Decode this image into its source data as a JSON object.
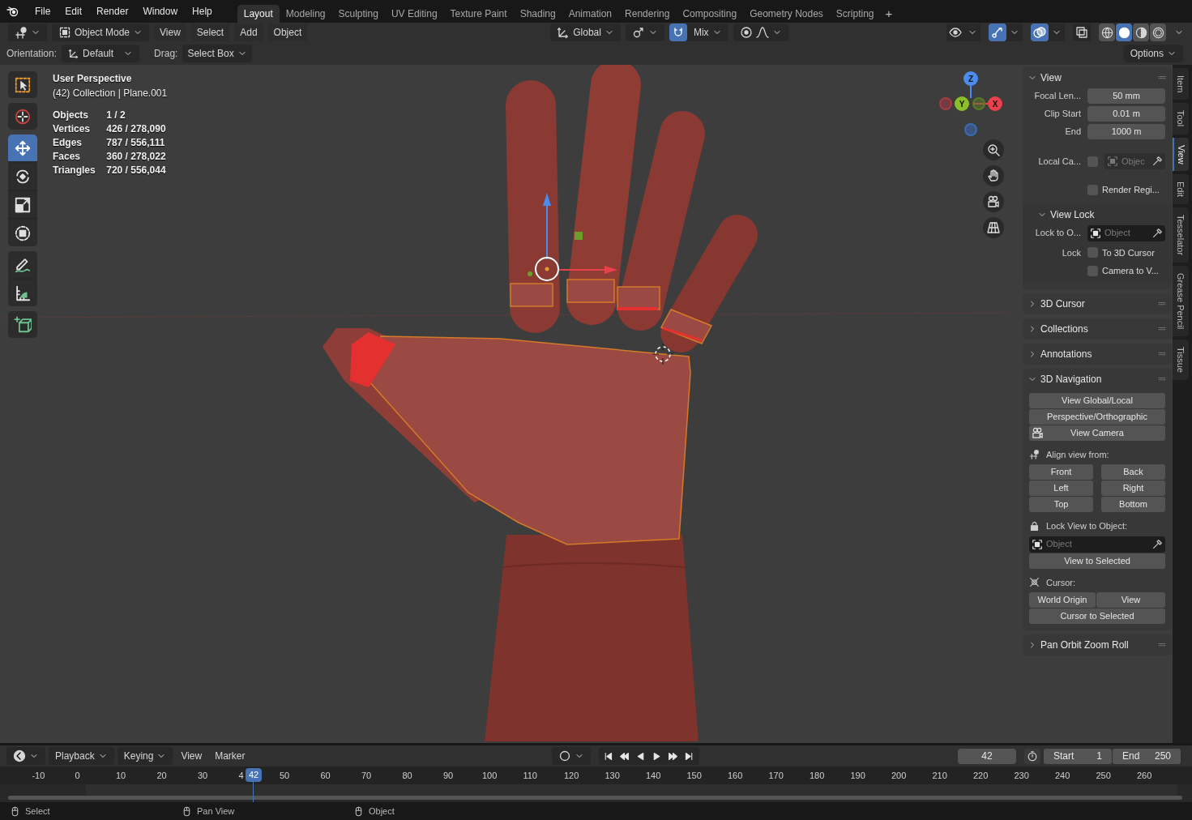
{
  "menu_bar": {
    "menus": [
      "File",
      "Edit",
      "Render",
      "Window",
      "Help"
    ],
    "workspaces": [
      {
        "label": "Layout",
        "selected": true
      },
      {
        "label": "Modeling",
        "selected": false
      },
      {
        "label": "Sculpting",
        "selected": false
      },
      {
        "label": "UV Editing",
        "selected": false
      },
      {
        "label": "Texture Paint",
        "selected": false
      },
      {
        "label": "Shading",
        "selected": false
      },
      {
        "label": "Animation",
        "selected": false
      },
      {
        "label": "Rendering",
        "selected": false
      },
      {
        "label": "Compositing",
        "selected": false
      },
      {
        "label": "Geometry Nodes",
        "selected": false
      },
      {
        "label": "Scripting",
        "selected": false
      }
    ],
    "add_tab": "+"
  },
  "header": {
    "mode": "Object Mode",
    "menus": [
      "View",
      "Select",
      "Add",
      "Object"
    ],
    "orientation": "Global",
    "snap_on": true,
    "snap_target": "Mix",
    "viewport_toggles": [
      {
        "kind": "visibility",
        "on": false
      },
      {
        "kind": "gizmos",
        "on": true
      },
      {
        "kind": "overlays",
        "on": true
      },
      {
        "kind": "xray",
        "on": false
      }
    ],
    "shading_modes": [
      {
        "kind": "wireframe",
        "selected": false
      },
      {
        "kind": "solid",
        "selected": true
      },
      {
        "kind": "material",
        "selected": false
      },
      {
        "kind": "rendered",
        "selected": false
      }
    ]
  },
  "tool_settings": {
    "orientation_label": "Orientation:",
    "orientation": "Default",
    "drag_label": "Drag:",
    "drag": "Select Box",
    "options": "Options"
  },
  "tool_groups": [
    {
      "tools": [
        {
          "kind": "select",
          "selected": false
        }
      ]
    },
    {
      "tools": [
        {
          "kind": "cursor",
          "selected": false
        }
      ]
    },
    {
      "tools": [
        {
          "kind": "move",
          "selected": true
        },
        {
          "kind": "rotate",
          "selected": false
        },
        {
          "kind": "scale",
          "selected": false
        },
        {
          "kind": "transform",
          "selected": false
        }
      ]
    },
    {
      "tools": [
        {
          "kind": "annotate",
          "selected": false
        },
        {
          "kind": "measure",
          "selected": false
        }
      ]
    },
    {
      "tools": [
        {
          "kind": "add-cube",
          "selected": false
        }
      ]
    }
  ],
  "viewport": {
    "title": "User Perspective",
    "context": "(42) Collection | Plane.001",
    "stats": [
      {
        "label": "Objects",
        "value": "1 / 2"
      },
      {
        "label": "Vertices",
        "value": "426 / 278,090"
      },
      {
        "label": "Edges",
        "value": "787 / 556,111"
      },
      {
        "label": "Faces",
        "value": "360 / 278,022"
      },
      {
        "label": "Triangles",
        "value": "720 / 556,044"
      }
    ],
    "axes": [
      "Z",
      "Y",
      "X"
    ]
  },
  "sidebar": {
    "panels": [
      {
        "kind": "view",
        "title": "View",
        "expanded": true,
        "fields": [
          {
            "label": "Focal Len...",
            "value": "50 mm"
          },
          {
            "label": "Clip Start",
            "value": "0.01 m"
          },
          {
            "label": "End",
            "value": "1000 m"
          }
        ],
        "local_camera": {
          "label": "Local Ca...",
          "checked": false,
          "placeholder": "Objec"
        },
        "render_region": {
          "label": "Render Regi...",
          "checked": false
        },
        "view_lock": {
          "title": "View Lock",
          "expanded": true,
          "object_label": "Lock to O...",
          "object_placeholder": "Object",
          "lock_label": "Lock",
          "options": [
            {
              "label": "To 3D Cursor",
              "checked": false
            },
            {
              "label": "Camera to V...",
              "checked": false
            }
          ]
        }
      },
      {
        "kind": "plain",
        "title": "3D Cursor",
        "expanded": false
      },
      {
        "kind": "plain",
        "title": "Collections",
        "expanded": false
      },
      {
        "kind": "plain",
        "title": "Annotations",
        "expanded": false
      },
      {
        "kind": "navigation",
        "title": "3D Navigation",
        "expanded": true,
        "buttons": [
          "View Global/Local",
          "Perspective/Orthographic"
        ],
        "camera_button": "View Camera",
        "align_label": "Align view from:",
        "align_buttons": [
          "Front",
          "Back",
          "Left",
          "Right",
          "Top",
          "Bottom"
        ],
        "lock_label": "Lock View to Object:",
        "lock_placeholder": "Object",
        "view_selected": "View to Selected",
        "cursor_label": "Cursor:",
        "cursor_buttons": [
          "World Origin",
          "View"
        ],
        "cursor_selected": "Cursor to Selected"
      },
      {
        "kind": "plain",
        "title": "Pan Orbit Zoom Roll",
        "expanded": false
      }
    ],
    "tabs": [
      {
        "label": "Item",
        "selected": false
      },
      {
        "label": "Tool",
        "selected": false
      },
      {
        "label": "View",
        "selected": true
      },
      {
        "label": "Edit",
        "selected": false
      },
      {
        "label": "Tesselator",
        "selected": false
      },
      {
        "label": "Grease Pencil",
        "selected": false
      },
      {
        "label": "Tissue",
        "selected": false
      }
    ]
  },
  "timeline": {
    "menus": [
      "Playback",
      "Keying",
      "View",
      "Marker"
    ],
    "current_frame": "42",
    "start_label": "Start",
    "start": "1",
    "end_label": "End",
    "end": "250",
    "ticks": [
      "-10",
      "0",
      "10",
      "20",
      "30",
      "4",
      "50",
      "60",
      "70",
      "80",
      "90",
      "100",
      "110",
      "120",
      "130",
      "140",
      "150",
      "160",
      "170",
      "180",
      "190",
      "200",
      "210",
      "220",
      "230",
      "240",
      "250",
      "260"
    ],
    "playhead": "42"
  },
  "status_bar": [
    {
      "label": "Select"
    },
    {
      "label": "Pan View"
    },
    {
      "label": "Object"
    }
  ]
}
